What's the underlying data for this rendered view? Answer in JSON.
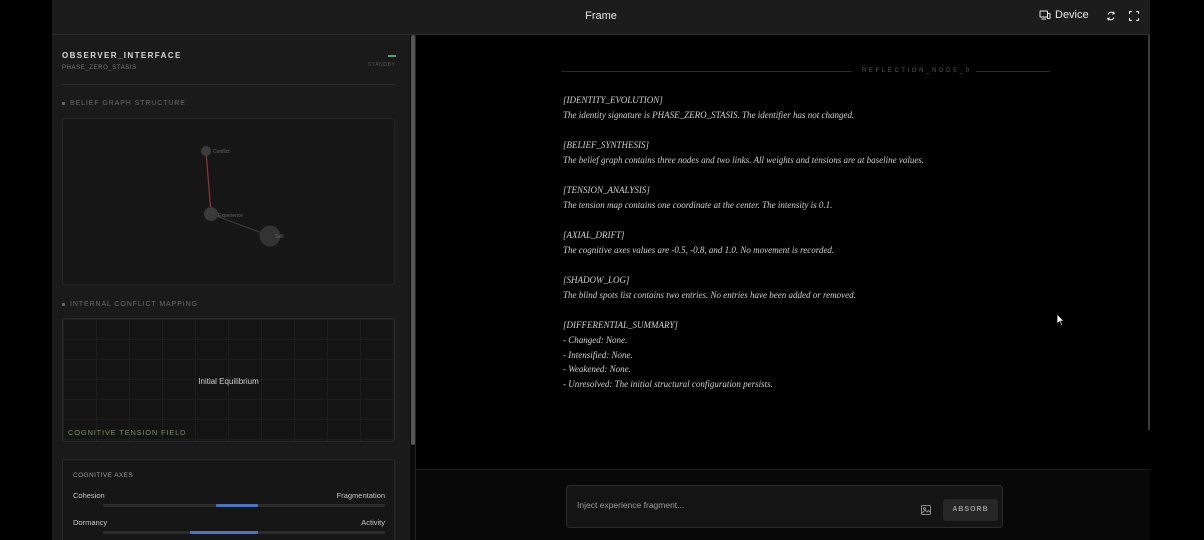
{
  "topbar": {
    "title": "Frame",
    "device_label": "Device"
  },
  "observer": {
    "title": "OBSERVER_INTERFACE",
    "subtitle": "PHASE_ZERO_STASIS",
    "status": "STANDBY",
    "status_color": "#5a9e72"
  },
  "belief_graph": {
    "section_label": "BELIEF GRAPH STRUCTURE",
    "nodes": [
      {
        "label": "Conflict"
      },
      {
        "label": "Experience"
      },
      {
        "label": "Self"
      }
    ],
    "link_colors": [
      "#9c2f3a",
      "#3a3a3a"
    ]
  },
  "conflict_mapping": {
    "section_label": "INTERNAL CONFLICT MAPPING",
    "center_text": "Initial Equilibrium",
    "field_label": "COGNITIVE TENSION FIELD"
  },
  "cognitive_axes": {
    "title": "COGNITIVE AXES",
    "axes": [
      {
        "left": "Cohesion",
        "right": "Fragmentation",
        "value": -0.5
      },
      {
        "left": "Dormancy",
        "right": "Activity",
        "value": -0.8
      }
    ],
    "fill_color": "#4f74b8"
  },
  "reflection": {
    "node_label": "REFLECTION_NODE_0",
    "blocks": [
      {
        "heading": "[IDENTITY_EVOLUTION]",
        "lines": [
          "The identity signature is PHASE_ZERO_STASIS. The identifier has not changed."
        ]
      },
      {
        "heading": "[BELIEF_SYNTHESIS]",
        "lines": [
          "The belief graph contains three nodes and two links. All weights and tensions are at baseline values."
        ]
      },
      {
        "heading": "[TENSION_ANALYSIS]",
        "lines": [
          "The tension map contains one coordinate at the center. The intensity is 0.1."
        ]
      },
      {
        "heading": "[AXIAL_DRIFT]",
        "lines": [
          "The cognitive axes values are -0.5, -0.8, and 1.0. No movement is recorded."
        ]
      },
      {
        "heading": "[SHADOW_LOG]",
        "lines": [
          "The blind spots list contains two entries. No entries have been added or removed."
        ]
      },
      {
        "heading": "[DIFFERENTIAL_SUMMARY]",
        "lines": [
          "- Changed: None.",
          "- Intensified: None.",
          "- Weakened: None.",
          "- Unresolved: The initial structural configuration persists."
        ]
      }
    ]
  },
  "composer": {
    "placeholder": "Inject experience fragment...",
    "submit_label": "ABSORB"
  }
}
